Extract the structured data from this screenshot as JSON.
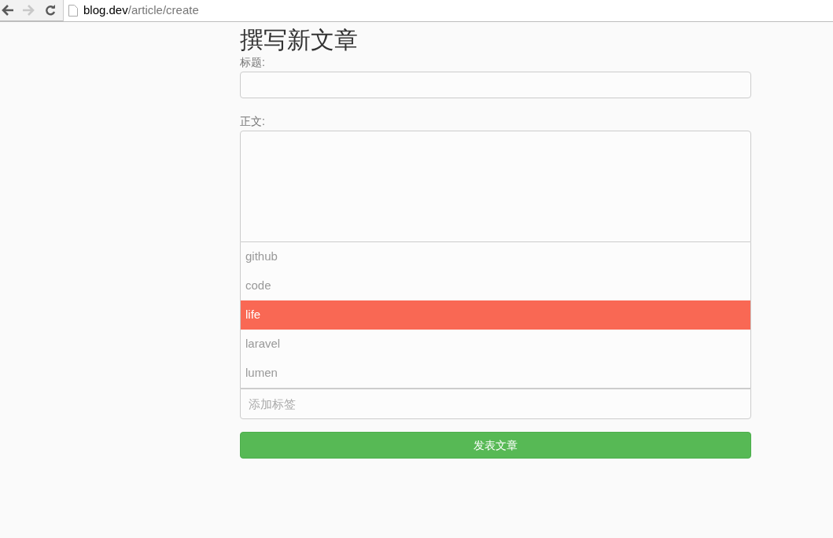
{
  "browser": {
    "back_disabled": false,
    "forward_disabled": true,
    "url_host": "blog.dev",
    "url_path": "/article/create"
  },
  "page": {
    "heading": "撰写新文章",
    "title_label": "标题:",
    "body_label": "正文:"
  },
  "tag_suggestions": [
    {
      "label": "github",
      "selected": false
    },
    {
      "label": "code",
      "selected": false
    },
    {
      "label": "life",
      "selected": true
    },
    {
      "label": "laravel",
      "selected": false
    },
    {
      "label": "lumen",
      "selected": false
    }
  ],
  "tag_input": {
    "placeholder": "添加标签"
  },
  "submit_button": "发表文章"
}
